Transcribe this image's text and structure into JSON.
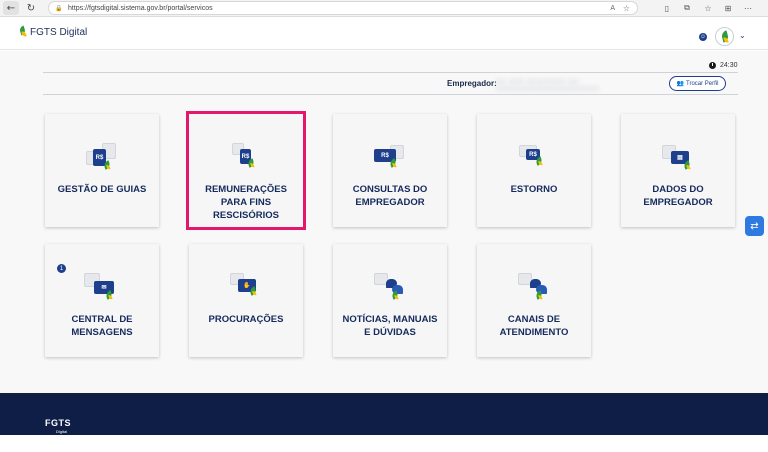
{
  "browser": {
    "url": "https://fgtsdigital.sistema.gov.br/portal/servicos",
    "back_icon": "arrow-left-icon",
    "reload_icon": "reload-icon"
  },
  "header": {
    "brand": "FGTS Digital"
  },
  "session": {
    "clock": "24:30",
    "employer_label": "Empregador:",
    "employer_value": "XX.XXX.XXX/XXXX-XX - XXXXXXXXXXXXXXXXXXXX",
    "switch_profile": "Trocar Perfil"
  },
  "cards": [
    {
      "label": "GESTÃO DE GUIAS",
      "icon": "guides-icon"
    },
    {
      "label": "REMUNERAÇÕES PARA FINS RESCISÓRIOS",
      "icon": "remuneration-icon",
      "selected": true
    },
    {
      "label": "CONSULTAS DO EMPREGADOR",
      "icon": "employer-query-icon"
    },
    {
      "label": "ESTORNO",
      "icon": "refund-icon"
    },
    {
      "label": "DADOS DO EMPREGADOR",
      "icon": "employer-data-icon"
    },
    {
      "label": "CENTRAL DE MENSAGENS",
      "icon": "messages-icon",
      "badge": "1"
    },
    {
      "label": "PROCURAÇÕES",
      "icon": "power-of-attorney-icon"
    },
    {
      "label": "NOTÍCIAS, MANUAIS E DÚVIDAS",
      "icon": "news-icon"
    },
    {
      "label": "CANAIS DE ATENDIMENTO",
      "icon": "support-channels-icon"
    }
  ],
  "footer": {
    "brand": "FGTS",
    "sub": "Digital"
  },
  "colors": {
    "primary": "#1d3f8c",
    "footer": "#0e1e47",
    "selection": "#e3186a",
    "leaf_green": "#2f9a3c",
    "leaf_yellow": "#f2c200"
  }
}
